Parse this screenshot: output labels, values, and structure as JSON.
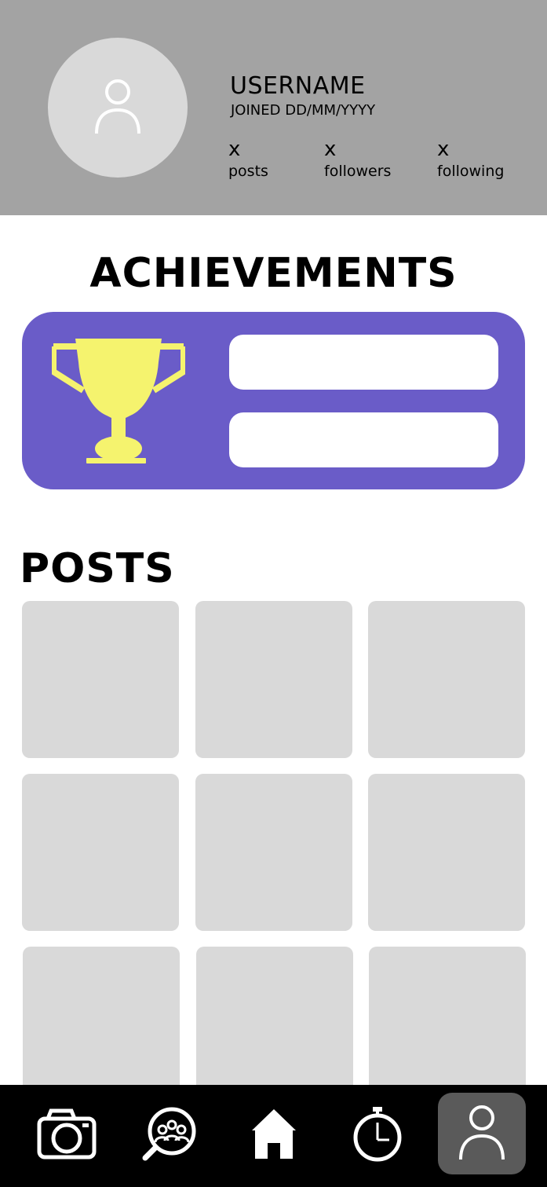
{
  "profile": {
    "username": "USERNAME",
    "joined": "JOINED DD/MM/YYYY",
    "stats": [
      {
        "count": "x",
        "label": "posts"
      },
      {
        "count": "x",
        "label": "followers"
      },
      {
        "count": "x",
        "label": "following"
      }
    ]
  },
  "achievements": {
    "title": "ACHIEVEMENTS",
    "slots": [
      "",
      ""
    ]
  },
  "posts": {
    "title": "POSTS",
    "tile_count": 9
  },
  "nav": {
    "items": [
      {
        "icon": "camera-icon",
        "active": false
      },
      {
        "icon": "search-people-icon",
        "active": false
      },
      {
        "icon": "home-icon",
        "active": false
      },
      {
        "icon": "stopwatch-icon",
        "active": false
      },
      {
        "icon": "profile-icon",
        "active": true
      }
    ]
  },
  "colors": {
    "header_bg": "#a3a3a3",
    "avatar_bg": "#d9d9d9",
    "achievement_card": "#6a5cc8",
    "trophy": "#f5f36e",
    "nav_bg": "#000000",
    "nav_active": "#5a5a5a"
  }
}
